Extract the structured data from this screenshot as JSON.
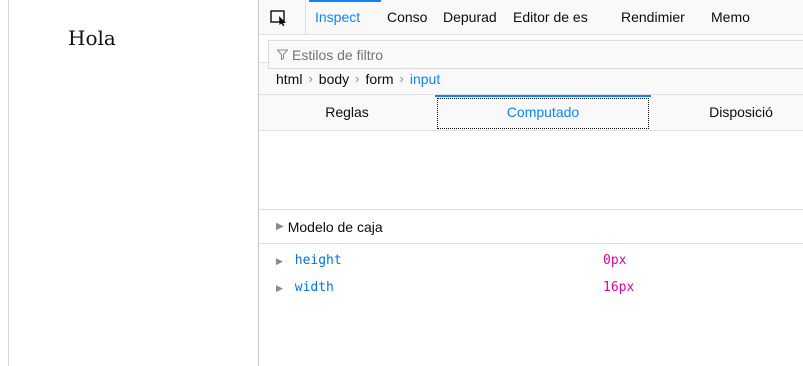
{
  "page": {
    "text": "Hola"
  },
  "devtools": {
    "tabs": [
      {
        "label": "Inspect",
        "active": true
      },
      {
        "label": "Conso",
        "active": false
      },
      {
        "label": "Depurad",
        "active": false
      },
      {
        "label": "Editor de es",
        "active": false
      },
      {
        "label": "Rendimier",
        "active": false
      },
      {
        "label": "Memo",
        "active": false
      }
    ],
    "add_rule_symbol": "+",
    "breadcrumb": [
      {
        "label": "html",
        "active": false
      },
      {
        "label": "body",
        "active": false
      },
      {
        "label": "form",
        "active": false
      },
      {
        "label": "input",
        "active": true
      }
    ],
    "breadcrumb_separator": "›",
    "subtabs": {
      "rules": "Reglas",
      "computed": "Computado",
      "layout": "Disposició"
    },
    "filter": {
      "placeholder": "Estilos de filtro"
    },
    "box_model": {
      "label": "Modelo de caja"
    },
    "properties": [
      {
        "name": "height",
        "value": "0px"
      },
      {
        "name": "width",
        "value": "16px"
      }
    ],
    "colors": {
      "accent": "#0a84ff",
      "property_name": "#0074e8",
      "property_value": "#dd00a9"
    }
  }
}
